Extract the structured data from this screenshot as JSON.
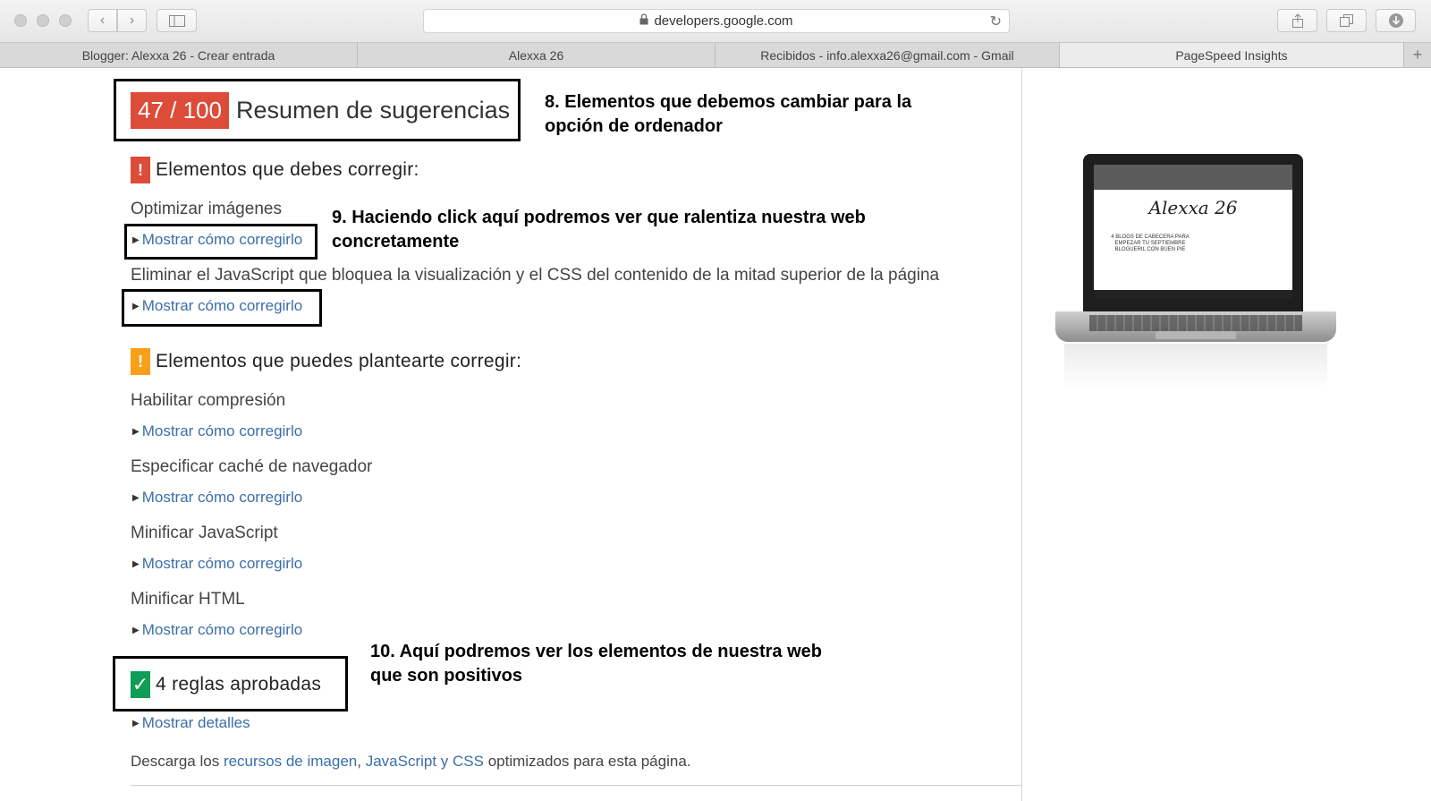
{
  "browser": {
    "url": "developers.google.com",
    "tabs": [
      {
        "label": "Blogger: Alexxa 26 - Crear entrada"
      },
      {
        "label": "Alexxa 26"
      },
      {
        "label": "Recibidos - info.alexxa26@gmail.com - Gmail"
      },
      {
        "label": "PageSpeed Insights"
      }
    ],
    "new_tab_symbol": "+"
  },
  "summary": {
    "score": "47 / 100",
    "title": "Resumen de sugerencias"
  },
  "must_fix": {
    "icon_text": "!",
    "title": "Elementos que debes corregir:",
    "rules": [
      {
        "name": "Optimizar imágenes",
        "link": "Mostrar cómo corregirlo"
      },
      {
        "name": "Eliminar el JavaScript que bloquea la visualización y el CSS del contenido de la mitad superior de la página",
        "link": "Mostrar cómo corregirlo"
      }
    ]
  },
  "consider_fix": {
    "icon_text": "!",
    "title": "Elementos que puedes plantearte corregir:",
    "rules": [
      {
        "name": "Habilitar compresión",
        "link": "Mostrar cómo corregirlo"
      },
      {
        "name": "Especificar caché de navegador",
        "link": "Mostrar cómo corregirlo"
      },
      {
        "name": "Minificar JavaScript",
        "link": "Mostrar cómo corregirlo"
      },
      {
        "name": "Minificar HTML",
        "link": "Mostrar cómo corregirlo"
      }
    ]
  },
  "passed": {
    "icon_text": "✓",
    "title": "4 reglas aprobadas",
    "link": "Mostrar detalles"
  },
  "footer": {
    "prefix": "Descarga los ",
    "link1": "recursos de imagen",
    "sep": ", ",
    "link2": "JavaScript y CSS",
    "suffix": " optimizados para esta página."
  },
  "annotations": {
    "a8": "8. Elementos que debemos cambiar para la opción de ordenador",
    "a9": "9. Haciendo click aquí podremos ver que ralentiza nuestra web concretamente",
    "a10": "10. Aquí podremos ver los elementos de nuestra web que son positivos"
  },
  "preview": {
    "logo": "Alexxa 26",
    "headline": "4 BLOGS DE CABECERA PARA EMPEZAR TU SEPTIEMBRE BLOGUERIL CON BUEN PIE"
  },
  "colors": {
    "score_bg": "#dd4b39",
    "must_fix": "#dd4b39",
    "consider_fix": "#f9a01b",
    "passed": "#0f9d58",
    "link": "#3b6ea8"
  },
  "icons": [
    "lock-icon",
    "reload-icon",
    "back-icon",
    "forward-icon",
    "sidebar-icon",
    "share-icon",
    "tabs-icon",
    "download-icon"
  ]
}
